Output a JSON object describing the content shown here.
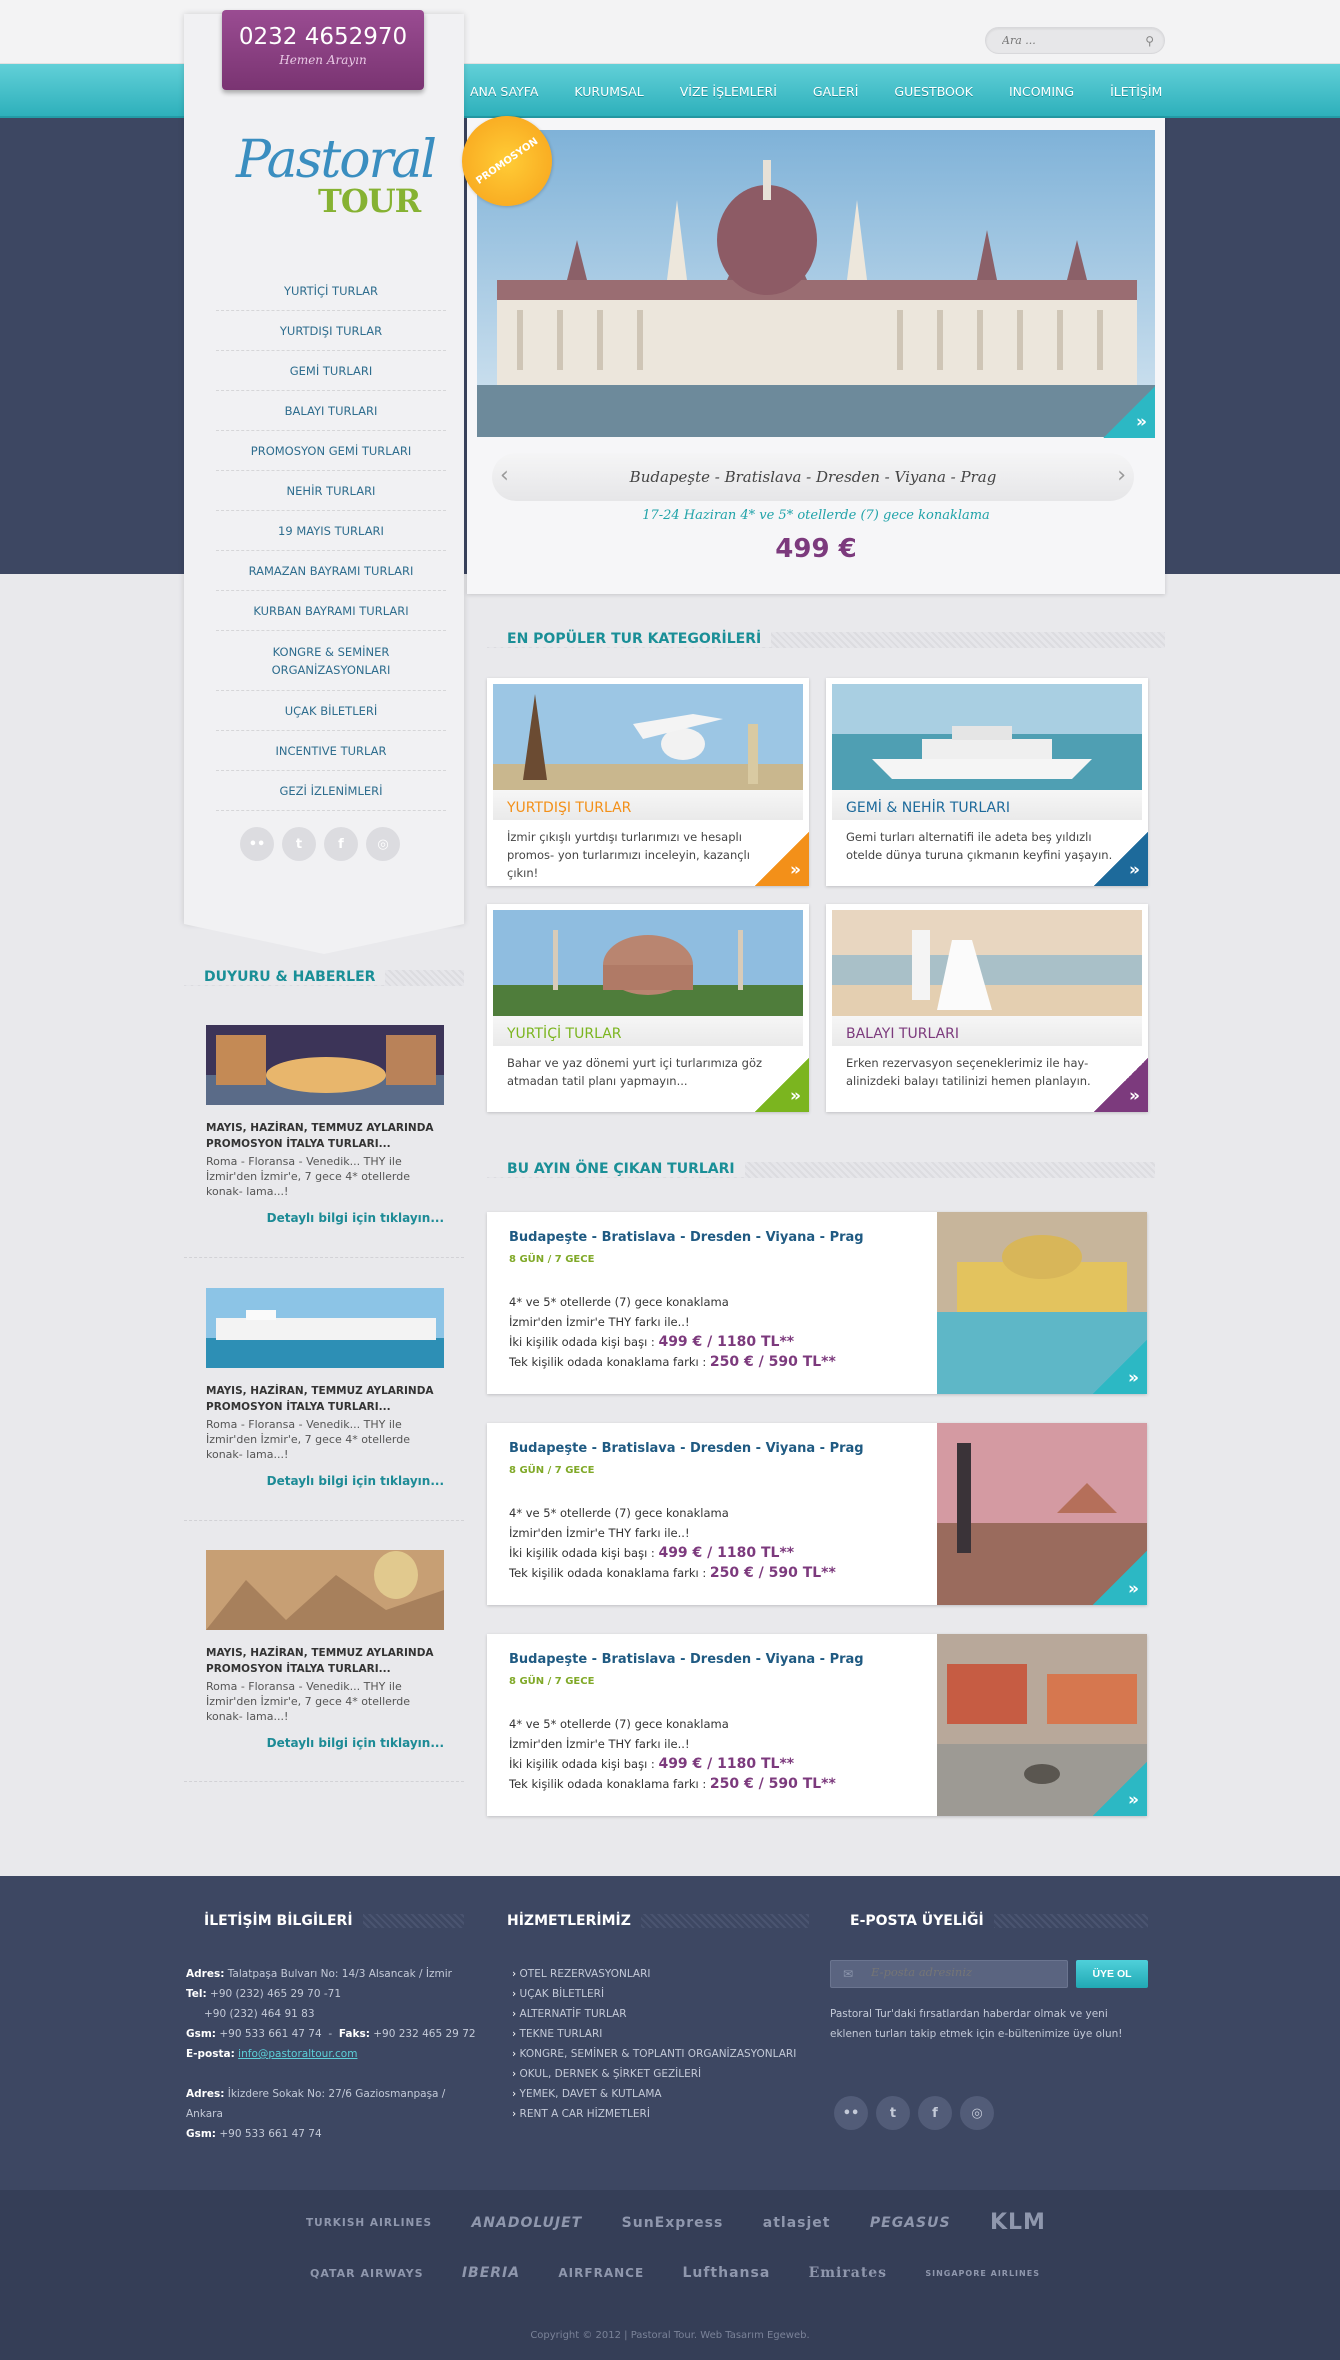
{
  "phone": {
    "number": "0232 4652970",
    "call": "Hemen Arayın"
  },
  "search": {
    "placeholder": "Ara ..."
  },
  "nav": [
    "ANA SAYFA",
    "KURUMSAL",
    "VİZE İŞLEMLERİ",
    "GALERİ",
    "GUESTBOOK",
    "INCOMING",
    "İLETİŞİM"
  ],
  "logo": {
    "word1": "Pastoral",
    "word2": "TOUR"
  },
  "sidebar_menu": [
    "YURTİÇİ TURLAR",
    "YURTDIŞI TURLAR",
    "GEMİ TURLARI",
    "BALAYI TURLARI",
    "PROMOSYON GEMİ TURLARI",
    "NEHİR TURLARI",
    "19 MAYIS TURLARI",
    "RAMAZAN BAYRAMI TURLARI",
    "KURBAN BAYRAMI TURLARI",
    "KONGRE & SEMİNER ORGANİZASYONLARI",
    "UÇAK BİLETLERİ",
    "INCENTIVE TURLAR",
    "GEZİ İZLENİMLERİ"
  ],
  "slider": {
    "badge": "PROMOSYON",
    "title": "Budapeşte  - Bratislava - Dresden - Viyana - Prag",
    "subtitle": "17-24 Haziran 4* ve 5* otellerde (7) gece konaklama",
    "price": "499 €"
  },
  "sections": {
    "popular": "EN POPÜLER TUR KATEGORİLERİ",
    "featured": "BU AYIN ÖNE ÇIKAN TURLARI",
    "news": "DUYURU & HABERLER"
  },
  "categories": [
    {
      "title": "YURTDIŞI TURLAR",
      "text": "İzmir çıkışlı yurtdışı turlarımızı ve hesaplı promos- yon turlarımızı inceleyin, kazançlı çıkın!",
      "color": "#f39019"
    },
    {
      "title": "GEMİ & NEHİR TURLARI",
      "text": "Gemi turları alternatifi ile adeta beş yıldızlı otelde dünya turuna çıkmanın keyfini yaşayın.",
      "color": "#1d6a9b"
    },
    {
      "title": "YURTİÇİ TURLAR",
      "text": "Bahar ve yaz dönemi yurt içi turlarımıza göz atmadan tatil planı yapmayın...",
      "color": "#7bb51f"
    },
    {
      "title": "BALAYI TURLARI",
      "text": "Erken rezervasyon seçeneklerimiz ile hay- alinizdeki balayı tatilinizi hemen planlayın.",
      "color": "#7c3a7d"
    }
  ],
  "offers": [
    {
      "title": "Budapeşte - Bratislava - Dresden - Viyana - Prag",
      "duration": "8 GÜN / 7 GECE",
      "line1": "4* ve 5* otellerde (7) gece konaklama",
      "line2": "İzmir'den İzmir'e THY farkı ile..!",
      "line3_label": "İki kişilik odada kişi başı : ",
      "line3_price": "499 € / 1180 TL**",
      "line4_label": "Tek kişilik odada konaklama farkı : ",
      "line4_price": "250 € / 590 TL**"
    },
    {
      "title": "Budapeşte - Bratislava - Dresden - Viyana - Prag",
      "duration": "8 GÜN / 7 GECE",
      "line1": "4* ve 5* otellerde (7) gece konaklama",
      "line2": "İzmir'den İzmir'e THY farkı ile..!",
      "line3_label": "İki kişilik odada kişi başı : ",
      "line3_price": "499 € / 1180 TL**",
      "line4_label": "Tek kişilik odada konaklama farkı : ",
      "line4_price": "250 € / 590 TL**"
    },
    {
      "title": "Budapeşte - Bratislava - Dresden - Viyana - Prag",
      "duration": "8 GÜN / 7 GECE",
      "line1": "4* ve 5* otellerde (7) gece konaklama",
      "line2": "İzmir'den İzmir'e THY farkı ile..!",
      "line3_label": "İki kişilik odada kişi başı : ",
      "line3_price": "499 € / 1180 TL**",
      "line4_label": "Tek kişilik odada konaklama farkı : ",
      "line4_price": "250 € / 590 TL**"
    }
  ],
  "news": [
    {
      "title": "MAYIS, HAZİRAN, TEMMUZ AYLARINDA PROMOSYON İTALYA TURLARI...",
      "text": "Roma - Floransa - Venedik... THY ile İzmir'den İzmir'e, 7 gece 4* otellerde konak- lama...!",
      "link": "Detaylı bilgi için tıklayın..."
    },
    {
      "title": "MAYIS, HAZİRAN, TEMMUZ AYLARINDA PROMOSYON İTALYA TURLARI...",
      "text": "Roma - Floransa - Venedik... THY ile İzmir'den İzmir'e, 7 gece 4* otellerde konak- lama...!",
      "link": "Detaylı bilgi için tıklayın..."
    },
    {
      "title": "MAYIS, HAZİRAN, TEMMUZ AYLARINDA PROMOSYON İTALYA TURLARI...",
      "text": "Roma - Floransa - Venedik... THY ile İzmir'den İzmir'e, 7 gece 4* otellerde konak- lama...!",
      "link": "Detaylı bilgi için tıklayın..."
    }
  ],
  "footer": {
    "contact_title": "İLETİŞİM BİLGİLERİ",
    "services_title": "HİZMETLERİMİZ",
    "email_title": "E-POSTA ÜYELİĞİ",
    "addr1_label": "Adres:",
    "addr1": "Talatpaşa Bulvarı No: 14/3 Alsancak / İzmir",
    "tel_label": "Tel:",
    "tel": "+90 (232) 465 29 70 -71",
    "tel2": "+90 (232) 464 91 83",
    "gsm_label": "Gsm:",
    "gsm": "+90 533 661 47 74",
    "fax_label": "Faks:",
    "fax": "+90 232 465 29 72",
    "mail_label": "E-posta:",
    "mail": "info@pastoraltour.com",
    "addr2_label": "Adres:",
    "addr2": "İkizdere Sokak No: 27/6 Gaziosmanpaşa / Ankara",
    "gsm2_label": "Gsm:",
    "gsm2": "+90 533 661 47 74",
    "services": [
      "OTEL REZERVASYONLARI",
      "UÇAK BİLETLERİ",
      "ALTERNATİF TURLAR",
      "TEKNE TURLARI",
      "KONGRE, SEMİNER & TOPLANTI ORGANİZASYONLARI",
      "OKUL, DERNEK & ŞİRKET GEZİLERİ",
      "YEMEK, DAVET & KUTLAMA",
      "RENT A CAR HİZMETLERİ"
    ],
    "email_placeholder": "E-posta adresiniz",
    "subscribe": "ÜYE OL",
    "email_text": "Pastoral Tur'daki fırsatlardan haberdar olmak ve yeni eklenen turları takip etmek için e-bültenimize üye olun!",
    "airlines_row1": [
      "TURKISH AIRLINES",
      "ANADOLUJET",
      "SunExpress",
      "atlasjet",
      "PEGASUS",
      "KLM"
    ],
    "airlines_row2": [
      "QATAR AIRWAYS",
      "IBERIA",
      "AIRFRANCE",
      "Lufthansa",
      "Emirates",
      "SINGAPORE AIRLINES"
    ],
    "copyright": "Copyright © 2012 | Pastoral Tour. Web Tasarım Egeweb."
  }
}
